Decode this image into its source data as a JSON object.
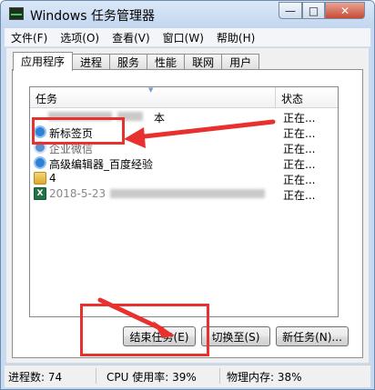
{
  "window": {
    "title": "Windows 任务管理器",
    "controls": {
      "minimize": "—",
      "maximize": "□",
      "close": "✕"
    }
  },
  "menu": [
    "文件(F)",
    "选项(O)",
    "查看(V)",
    "窗口(W)",
    "帮助(H)"
  ],
  "tabs": [
    {
      "label": "应用程序",
      "active": true
    },
    {
      "label": "进程"
    },
    {
      "label": "服务"
    },
    {
      "label": "性能"
    },
    {
      "label": "联网"
    },
    {
      "label": "用户"
    }
  ],
  "task_list": {
    "columns": {
      "task": "任务",
      "status": "状态"
    },
    "rows": [
      {
        "name": "本",
        "status": "正在...",
        "icon": "blurred-app-icon"
      },
      {
        "name": "新标签页",
        "status": "正在...",
        "icon": "ie-browser-icon"
      },
      {
        "name": "企业微信",
        "status": "正在...",
        "icon": "ie-browser-icon"
      },
      {
        "name": "高级编辑器_百度经验",
        "status": "正在...",
        "icon": "ie-browser-icon"
      },
      {
        "name": "4",
        "status": "正在...",
        "icon": "folder-icon"
      },
      {
        "name": "2018-5-23",
        "status": "正在...",
        "icon": "excel-icon"
      }
    ]
  },
  "buttons": {
    "end_task": "结束任务(E)",
    "switch_to": "切换至(S)",
    "new_task": "新任务(N)..."
  },
  "status_bar": {
    "processes": "进程数: 74",
    "cpu": "CPU 使用率: 39%",
    "memory": "物理内存: 38%"
  },
  "annotation_color": "#e8302f"
}
